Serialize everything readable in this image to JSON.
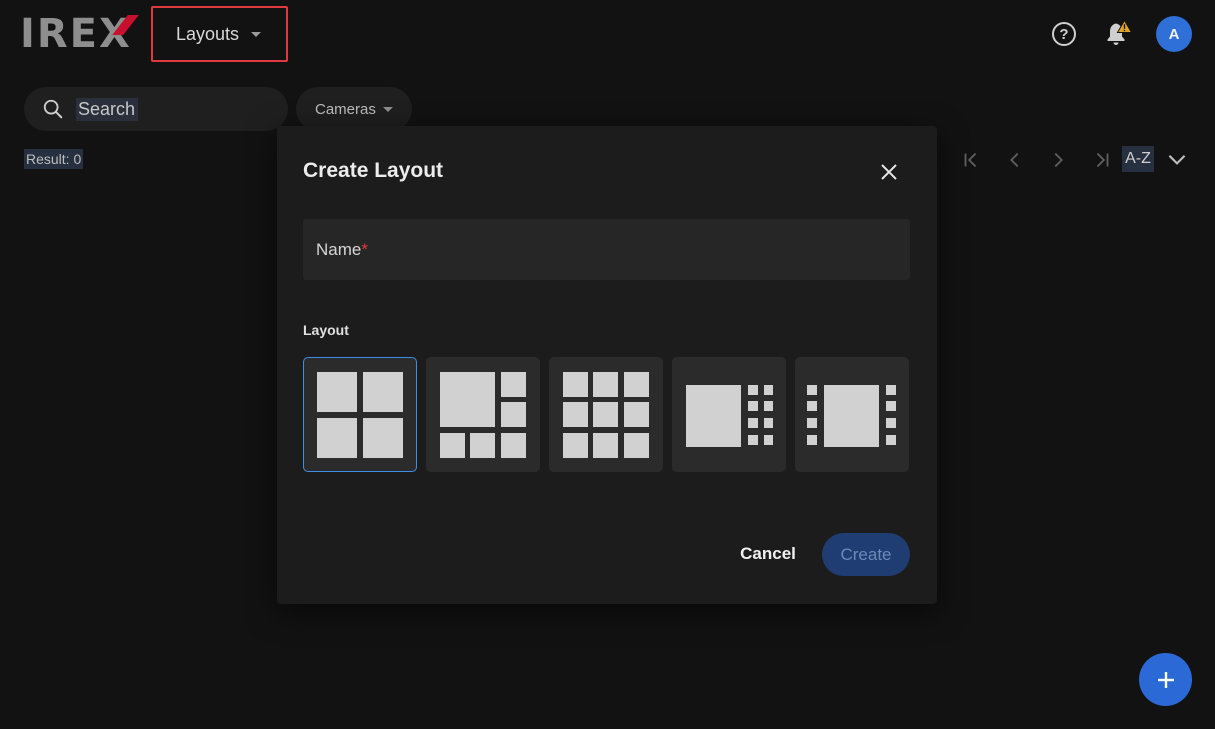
{
  "header": {
    "logo": "IREX",
    "menu_label": "Layouts",
    "avatar_initial": "A",
    "help_glyph": "?"
  },
  "toolbar": {
    "search_placeholder": "Search",
    "filter_label": "Cameras",
    "result_text": "Result: 0",
    "sort_label": "A-Z"
  },
  "dialog": {
    "title": "Create Layout",
    "name_label": "Name",
    "required_mark": "*",
    "layout_section": "Layout",
    "layout_options": [
      "grid-2x2",
      "1-big-5-small",
      "grid-3x3",
      "1-big-12-small",
      "1-big-side-strips"
    ],
    "selected_option": 0,
    "cancel_label": "Cancel",
    "create_label": "Create"
  },
  "colors": {
    "background": "#121212",
    "dialog": "#1c1c1c",
    "accent": "#2b6ad6",
    "highlight_border": "#e0393e",
    "selected_border": "#3b8fe6",
    "notification_badge": "#e0a526"
  },
  "icons": [
    "search-icon",
    "help-icon",
    "bell-icon",
    "close-icon",
    "first-page-icon",
    "prev-page-icon",
    "next-page-icon",
    "last-page-icon",
    "chevron-down-icon",
    "plus-icon"
  ]
}
